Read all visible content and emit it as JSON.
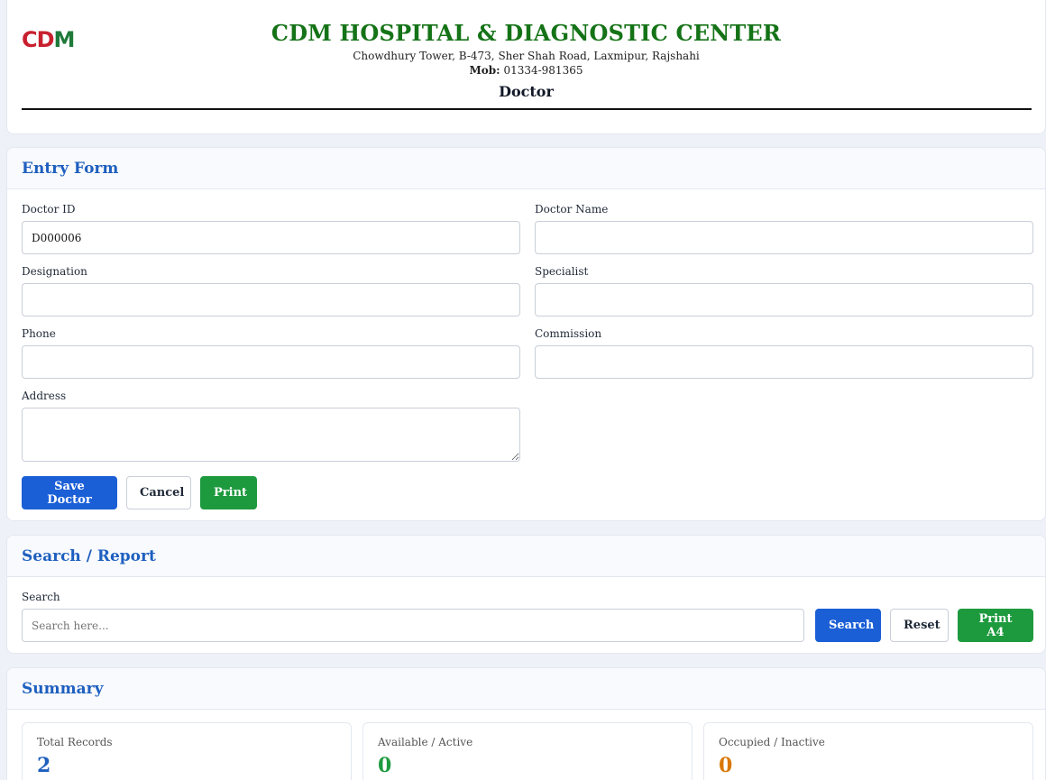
{
  "header": {
    "logo": {
      "c": "C",
      "d": "D",
      "m": "M"
    },
    "title": "CDM HOSPITAL & DIAGNOSTIC CENTER",
    "address": "Chowdhury Tower, B-473, Sher Shah Road, Laxmipur, Rajshahi",
    "mob_label": "Mob:",
    "mob_value": "01334-981365",
    "page_heading": "Doctor"
  },
  "entry_form": {
    "title": "Entry Form",
    "fields": {
      "doctor_id": {
        "label": "Doctor ID",
        "value": "D000006",
        "placeholder": ""
      },
      "doctor_name": {
        "label": "Doctor Name",
        "value": "",
        "placeholder": ""
      },
      "designation": {
        "label": "Designation",
        "value": "",
        "placeholder": ""
      },
      "specialist": {
        "label": "Specialist",
        "value": "",
        "placeholder": ""
      },
      "phone": {
        "label": "Phone",
        "value": "",
        "placeholder": ""
      },
      "commission": {
        "label": "Commission",
        "value": "",
        "placeholder": ""
      },
      "address": {
        "label": "Address",
        "value": "",
        "placeholder": ""
      }
    },
    "buttons": {
      "save": "Save Doctor",
      "cancel": "Cancel",
      "print": "Print"
    }
  },
  "search_report": {
    "title": "Search / Report",
    "search_label": "Search",
    "search_placeholder": "Search here...",
    "search_value": "",
    "buttons": {
      "search": "Search",
      "reset": "Reset",
      "print_a4": "Print A4"
    }
  },
  "summary": {
    "title": "Summary",
    "stats": [
      {
        "label": "Total Records",
        "value": "2",
        "color": "#1e5fbf"
      },
      {
        "label": "Available / Active",
        "value": "0",
        "color": "#1e9a3e"
      },
      {
        "label": "Occupied / Inactive",
        "value": "0",
        "color": "#d97706"
      }
    ]
  },
  "colors": {
    "brand_green": "#157317",
    "accent_blue": "#1b5fd6",
    "action_green": "#1e9a3e",
    "section_title_blue": "#1e5fbf"
  }
}
